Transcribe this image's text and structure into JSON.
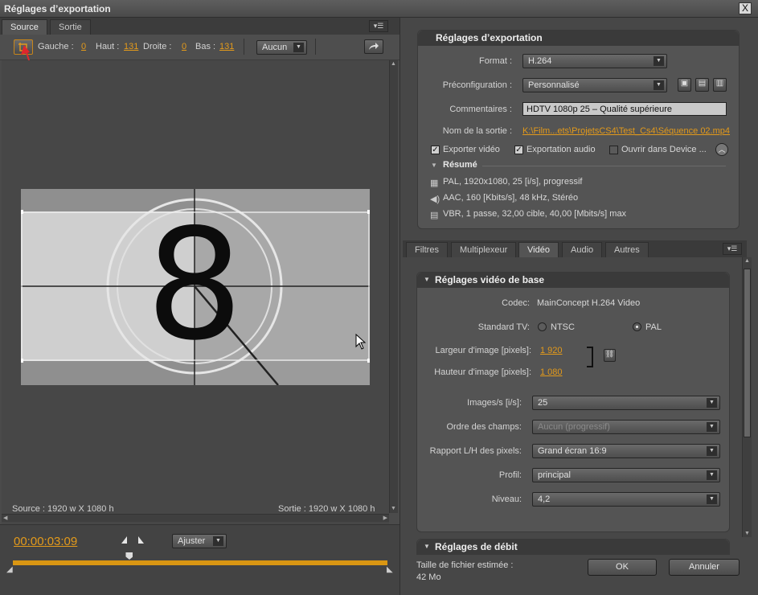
{
  "window": {
    "title": "Réglages d’exportation",
    "close": "X"
  },
  "left": {
    "tabs": [
      "Source",
      "Sortie"
    ],
    "crop": {
      "gauche_label": "Gauche :",
      "gauche": "0",
      "haut_label": "Haut :",
      "haut": "131",
      "droite_label": "Droite :",
      "droite": "0",
      "bas_label": "Bas :",
      "bas": "131",
      "ratio": "Aucun"
    },
    "preview": {
      "number": "8",
      "source_info": "Source : 1920 w X 1080 h",
      "output_info": "Sortie : 1920 w X 1080 h"
    },
    "timecode": "00:00:03:09",
    "fit": "Ajuster",
    "timeline_progress": 0.31
  },
  "export": {
    "heading": "Réglages d’exportation",
    "format_label": "Format :",
    "format": "H.264",
    "preset_label": "Préconfiguration :",
    "preset": "Personnalisé",
    "comments_label": "Commentaires :",
    "comments": "HDTV 1080p 25 – Qualité supérieure",
    "output_label": "Nom de la sortie :",
    "output": "K:\\Film...ets\\ProjetsCS4\\Test_Cs4\\Séquence 02.mp4",
    "export_video": "Exporter vidéo",
    "export_audio": "Exportation audio",
    "open_device": "Ouvrir dans Device ...",
    "summary_title": "Résumé",
    "summary": [
      "PAL, 1920x1080, 25 [i/s], progressif",
      "AAC, 160 [Kbits/s], 48 kHz, Stéréo",
      "VBR, 1 passe, 32,00 cible, 40,00 [Mbits/s] max"
    ]
  },
  "tabs2": [
    "Filtres",
    "Multiplexeur",
    "Vidéo",
    "Audio",
    "Autres"
  ],
  "video": {
    "heading": "Réglages vidéo de base",
    "codec_label": "Codec:",
    "codec": "MainConcept H.264 Video",
    "tv_label": "Standard TV:",
    "ntsc": "NTSC",
    "pal": "PAL",
    "width_label": "Largeur d'image [pixels]:",
    "width": "1 920",
    "height_label": "Hauteur d'image [pixels]:",
    "height": "1 080",
    "fps_label": "Images/s [i/s]:",
    "fps": "25",
    "field_label": "Ordre des champs:",
    "field": "Aucun (progressif)",
    "par_label": "Rapport L/H des pixels:",
    "par": "Grand écran 16:9",
    "profile_label": "Profil:",
    "profile": "principal",
    "level_label": "Niveau:",
    "level": "4,2",
    "bitrate_heading": "Réglages de débit"
  },
  "footer": {
    "size_label": "Taille de fichier estimée :",
    "size": "42 Mo",
    "ok": "OK",
    "cancel": "Annuler"
  },
  "colors": {
    "accent": "#e39a1b",
    "red_arrow": "#e0262c"
  }
}
